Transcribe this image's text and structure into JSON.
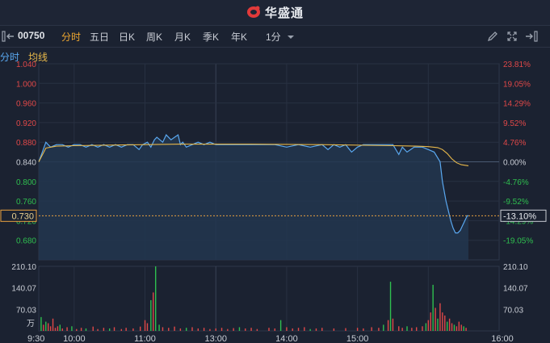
{
  "app": {
    "title": "华盛通"
  },
  "toolbar": {
    "stock_code": "00750",
    "tabs": [
      {
        "label": "分时",
        "active": true
      },
      {
        "label": "五日",
        "active": false
      },
      {
        "label": "日K",
        "active": false
      },
      {
        "label": "周K",
        "active": false
      },
      {
        "label": "月K",
        "active": false
      },
      {
        "label": "季K",
        "active": false
      },
      {
        "label": "年K",
        "active": false
      }
    ],
    "interval": "1分"
  },
  "legend": {
    "time_share": "分时",
    "avg_line": "均线"
  },
  "colors": {
    "background": "#1b2231",
    "price_line": "#5aa8f0",
    "avg_line": "#e8b84a",
    "up": "#e04848",
    "down": "#2fbf4f",
    "current": "#e8a040"
  },
  "chart_data": {
    "type": "line",
    "title": "",
    "xlabel": "",
    "ylabel": "",
    "prev_close": 0.84,
    "ylim": [
      0.64,
      1.04
    ],
    "price_ticks": [
      "1.040",
      "1.000",
      "0.960",
      "0.920",
      "0.880",
      "0.840",
      "0.800",
      "0.760",
      "0.720",
      "0.680"
    ],
    "pct_ticks": [
      "23.81%",
      "19.05%",
      "14.29%",
      "9.52%",
      "4.76%",
      "0.00%",
      "-4.76%",
      "-9.52%",
      "-14.29%",
      "-19.05%"
    ],
    "current_price": "0.730",
    "current_pct": "-13.10%",
    "x_ticks": [
      "9:30",
      "10:00",
      "11:00",
      "13:00",
      "14:00",
      "15:00",
      "16:00"
    ],
    "volume_ticks": [
      "210.10",
      "140.07",
      "70.03"
    ],
    "volume_unit": "万",
    "volume_max": 210.1,
    "series": [
      {
        "values": [
          [
            0,
            0.84
          ],
          [
            3,
            0.86
          ],
          [
            6,
            0.88
          ],
          [
            10,
            0.87
          ],
          [
            15,
            0.875
          ],
          [
            20,
            0.875
          ],
          [
            25,
            0.87
          ],
          [
            30,
            0.875
          ],
          [
            35,
            0.875
          ],
          [
            40,
            0.87
          ],
          [
            45,
            0.875
          ],
          [
            50,
            0.87
          ],
          [
            55,
            0.875
          ],
          [
            60,
            0.87
          ],
          [
            65,
            0.875
          ],
          [
            70,
            0.87
          ],
          [
            75,
            0.875
          ],
          [
            80,
            0.875
          ],
          [
            85,
            0.865
          ],
          [
            88,
            0.875
          ],
          [
            92,
            0.88
          ],
          [
            95,
            0.87
          ],
          [
            98,
            0.885
          ],
          [
            100,
            0.89
          ],
          [
            105,
            0.88
          ],
          [
            108,
            0.895
          ],
          [
            112,
            0.885
          ],
          [
            115,
            0.89
          ],
          [
            118,
            0.895
          ],
          [
            120,
            0.875
          ],
          [
            122,
            0.88
          ],
          [
            125,
            0.87
          ],
          [
            130,
            0.875
          ],
          [
            135,
            0.88
          ],
          [
            140,
            0.875
          ],
          [
            145,
            0.88
          ],
          [
            150,
            0.875
          ],
          [
            160,
            0.875
          ],
          [
            180,
            0.875
          ],
          [
            200,
            0.875
          ],
          [
            210,
            0.87
          ],
          [
            220,
            0.875
          ],
          [
            230,
            0.87
          ],
          [
            240,
            0.875
          ],
          [
            245,
            0.865
          ],
          [
            250,
            0.875
          ],
          [
            255,
            0.87
          ],
          [
            260,
            0.875
          ],
          [
            265,
            0.86
          ],
          [
            270,
            0.87
          ],
          [
            275,
            0.875
          ],
          [
            280,
            0.875
          ],
          [
            290,
            0.875
          ],
          [
            300,
            0.875
          ],
          [
            305,
            0.855
          ],
          [
            308,
            0.87
          ],
          [
            312,
            0.86
          ],
          [
            318,
            0.87
          ],
          [
            325,
            0.87
          ],
          [
            330,
            0.865
          ],
          [
            335,
            0.86
          ],
          [
            340,
            0.84
          ],
          [
            342,
            0.8
          ],
          [
            345,
            0.76
          ],
          [
            347,
            0.74
          ],
          [
            349,
            0.72
          ],
          [
            351,
            0.705
          ],
          [
            353,
            0.695
          ],
          [
            355,
            0.695
          ],
          [
            357,
            0.7
          ],
          [
            359,
            0.71
          ],
          [
            361,
            0.72
          ],
          [
            363,
            0.73
          ],
          [
            364,
            0.73
          ]
        ]
      },
      {
        "values": [
          [
            0,
            0.84
          ],
          [
            6,
            0.868
          ],
          [
            15,
            0.872
          ],
          [
            30,
            0.873
          ],
          [
            60,
            0.874
          ],
          [
            90,
            0.875
          ],
          [
            120,
            0.876
          ],
          [
            180,
            0.876
          ],
          [
            240,
            0.875
          ],
          [
            300,
            0.873
          ],
          [
            320,
            0.872
          ],
          [
            330,
            0.871
          ],
          [
            338,
            0.869
          ],
          [
            342,
            0.865
          ],
          [
            346,
            0.857
          ],
          [
            350,
            0.846
          ],
          [
            354,
            0.838
          ],
          [
            358,
            0.834
          ],
          [
            364,
            0.832
          ]
        ]
      }
    ],
    "volume": [
      [
        2,
        45
      ],
      [
        4,
        20
      ],
      [
        6,
        30
      ],
      [
        8,
        25
      ],
      [
        10,
        15
      ],
      [
        12,
        40
      ],
      [
        14,
        10
      ],
      [
        16,
        15
      ],
      [
        18,
        20
      ],
      [
        20,
        8
      ],
      [
        24,
        12
      ],
      [
        28,
        15
      ],
      [
        32,
        6
      ],
      [
        36,
        10
      ],
      [
        40,
        8
      ],
      [
        46,
        14
      ],
      [
        50,
        6
      ],
      [
        55,
        10
      ],
      [
        60,
        8
      ],
      [
        64,
        12
      ],
      [
        70,
        6
      ],
      [
        74,
        10
      ],
      [
        80,
        8
      ],
      [
        86,
        14
      ],
      [
        90,
        35
      ],
      [
        92,
        25
      ],
      [
        95,
        100
      ],
      [
        97,
        125
      ],
      [
        99,
        210
      ],
      [
        102,
        20
      ],
      [
        105,
        12
      ],
      [
        110,
        10
      ],
      [
        115,
        14
      ],
      [
        120,
        8
      ],
      [
        125,
        10
      ],
      [
        130,
        12
      ],
      [
        135,
        8
      ],
      [
        140,
        10
      ],
      [
        145,
        6
      ],
      [
        150,
        8
      ],
      [
        155,
        10
      ],
      [
        160,
        6
      ],
      [
        165,
        9
      ],
      [
        170,
        12
      ],
      [
        175,
        8
      ],
      [
        180,
        10
      ],
      [
        185,
        6
      ],
      [
        195,
        10
      ],
      [
        200,
        8
      ],
      [
        205,
        35
      ],
      [
        210,
        12
      ],
      [
        215,
        8
      ],
      [
        220,
        10
      ],
      [
        225,
        12
      ],
      [
        230,
        6
      ],
      [
        235,
        8
      ],
      [
        240,
        10
      ],
      [
        250,
        8
      ],
      [
        260,
        9
      ],
      [
        270,
        10
      ],
      [
        275,
        8
      ],
      [
        282,
        12
      ],
      [
        288,
        10
      ],
      [
        292,
        20
      ],
      [
        296,
        35
      ],
      [
        298,
        160
      ],
      [
        300,
        40
      ],
      [
        305,
        15
      ],
      [
        308,
        10
      ],
      [
        312,
        15
      ],
      [
        316,
        10
      ],
      [
        320,
        12
      ],
      [
        325,
        15
      ],
      [
        328,
        25
      ],
      [
        330,
        35
      ],
      [
        332,
        60
      ],
      [
        334,
        150
      ],
      [
        336,
        75
      ],
      [
        338,
        40
      ],
      [
        340,
        90
      ],
      [
        342,
        60
      ],
      [
        344,
        50
      ],
      [
        346,
        30
      ],
      [
        348,
        40
      ],
      [
        350,
        25
      ],
      [
        352,
        20
      ],
      [
        354,
        15
      ],
      [
        356,
        30
      ],
      [
        358,
        20
      ],
      [
        360,
        15
      ],
      [
        362,
        10
      ]
    ],
    "volume_up": [
      2,
      6,
      18,
      28,
      40,
      60,
      95,
      99,
      102,
      125,
      170,
      205,
      230,
      292,
      298,
      312,
      328,
      334,
      338,
      346,
      352,
      360
    ],
    "volume_down": [
      4,
      8,
      10,
      12,
      14,
      16,
      20,
      24,
      32,
      36,
      46,
      50,
      55,
      64,
      70,
      74,
      80,
      86,
      90,
      92,
      97,
      105,
      110,
      115,
      120,
      130,
      135,
      140,
      145,
      150,
      155,
      160,
      165,
      175,
      180,
      185,
      195,
      200,
      210,
      215,
      220,
      225,
      235,
      240,
      250,
      260,
      270,
      275,
      282,
      288,
      296,
      300,
      305,
      308,
      316,
      320,
      325,
      330,
      332,
      336,
      340,
      342,
      344,
      348,
      350,
      354,
      356,
      358,
      362
    ]
  }
}
